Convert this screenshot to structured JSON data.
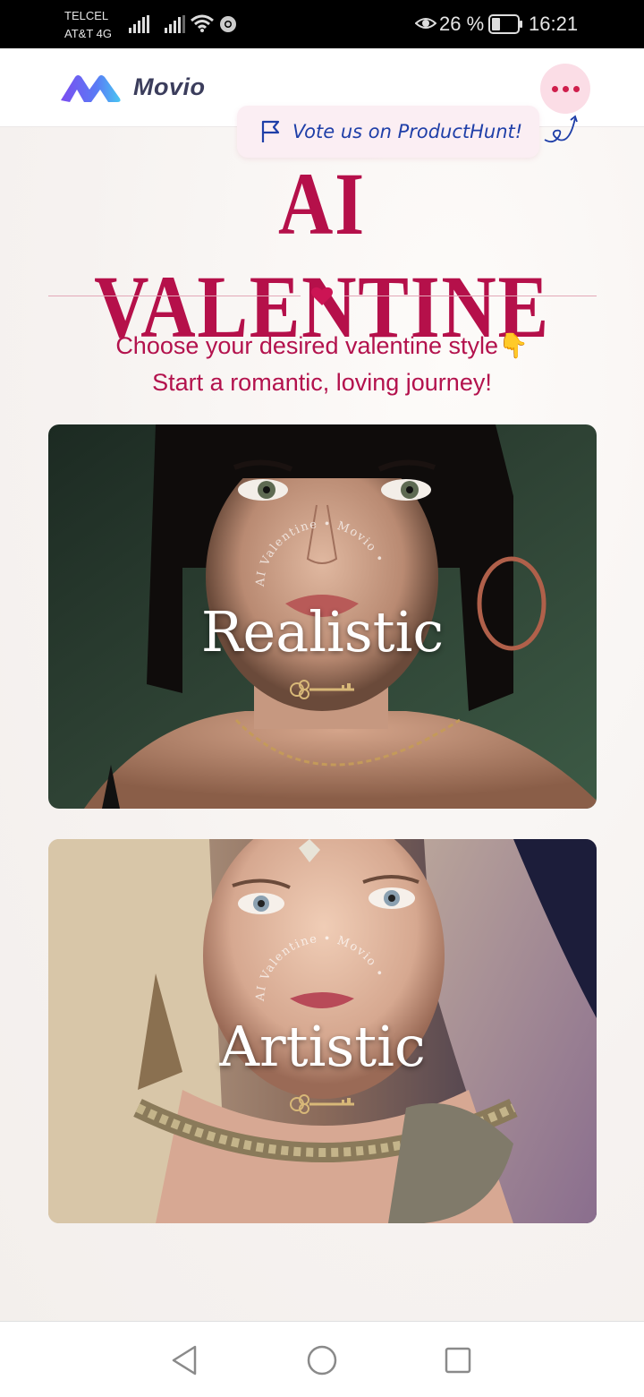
{
  "status_bar": {
    "carrier_line1": "TELCEL",
    "carrier_line2": "AT&T 4G",
    "battery_percent": "26 %",
    "time": "16:21",
    "icons": [
      "signal-icon",
      "signal-icon",
      "wifi-icon",
      "chrome-icon",
      "eye-icon",
      "battery-icon"
    ]
  },
  "header": {
    "logo_text": "Movio",
    "menu_icon": "more-dots-icon"
  },
  "promo": {
    "vote_text": "Vote us on ProductHunt!"
  },
  "hero": {
    "title": "AI VALENTINE",
    "subtitle_line1": "Choose your desired valentine style👇",
    "subtitle_line2": "Start a romantic, loving journey!"
  },
  "cards": [
    {
      "label": "Realistic",
      "seal_text": "AI Valentine • Movio •"
    },
    {
      "label": "Artistic",
      "seal_text": "AI Valentine • Movio •"
    }
  ],
  "colors": {
    "accent": "#b5104a",
    "menu_bg": "#fbdde6",
    "promo_text": "#1f3fa8"
  },
  "nav_bar": {
    "icons": [
      "back-icon",
      "home-icon",
      "recents-icon"
    ]
  }
}
